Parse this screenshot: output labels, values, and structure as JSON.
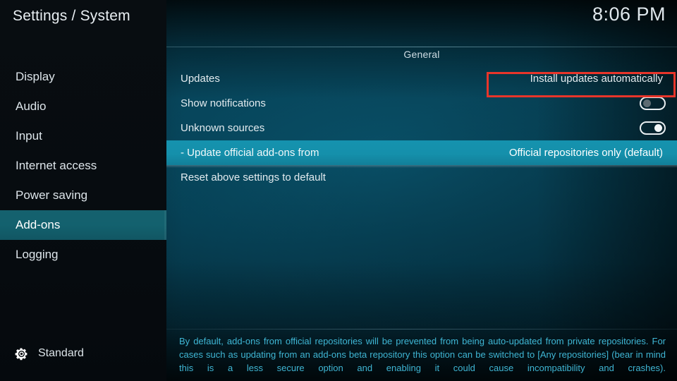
{
  "topbar": {
    "title": "Settings / System",
    "time": "8:06 PM"
  },
  "sidebar": {
    "items": [
      {
        "label": "Display",
        "selected": false
      },
      {
        "label": "Audio",
        "selected": false
      },
      {
        "label": "Input",
        "selected": false
      },
      {
        "label": "Internet access",
        "selected": false
      },
      {
        "label": "Power saving",
        "selected": false
      },
      {
        "label": "Add-ons",
        "selected": true
      },
      {
        "label": "Logging",
        "selected": false
      }
    ],
    "footer": {
      "icon": "gear-icon",
      "label": "Standard"
    }
  },
  "content": {
    "group_title": "General",
    "rows": [
      {
        "label": "Updates",
        "type": "value",
        "value": "Install updates automatically",
        "selected": false
      },
      {
        "label": "Show notifications",
        "type": "toggle",
        "toggle_on": false,
        "selected": false
      },
      {
        "label": "Unknown sources",
        "type": "toggle",
        "toggle_on": true,
        "selected": false
      },
      {
        "label": "- Update official add-ons from",
        "type": "value",
        "value": "Official repositories only (default)",
        "selected": true
      },
      {
        "label": "Reset above settings to default",
        "type": "action",
        "value": "",
        "selected": false
      }
    ],
    "help_text": "By default, add-ons from official repositories will be prevented from being auto-updated from private repositories. For cases such as updating from an add-ons beta repository this option can be switched to [Any repositories] (bear in mind this is a less secure option and enabling it could cause incompatibility and crashes)."
  },
  "annotation": {
    "color": "#e8352a",
    "target": "Official repositories only (default)"
  },
  "colors": {
    "sidebar_selected": "#15616e",
    "row_selected": "#1590ab",
    "help_text": "#3fb6d4",
    "annotation_red": "#e8352a"
  }
}
